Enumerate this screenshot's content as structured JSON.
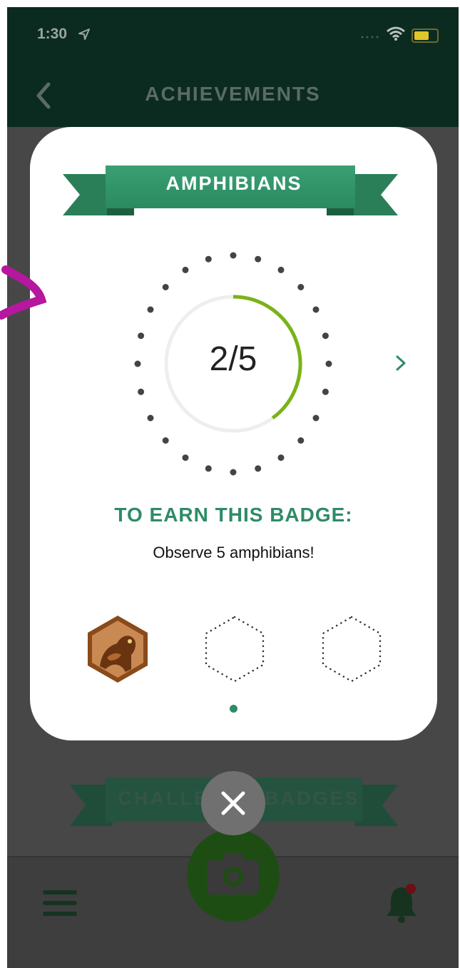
{
  "status_bar": {
    "time": "1:30"
  },
  "header": {
    "title": "ACHIEVEMENTS",
    "back_icon": "chevron-left-icon"
  },
  "modal": {
    "badge_title": "AMPHIBIANS",
    "progress": {
      "current": 2,
      "total": 5,
      "text": "2/5",
      "fraction": 0.4
    },
    "next_icon": "chevron-right-icon",
    "earn_heading": "TO EARN THIS BADGE:",
    "earn_description": "Observe 5 amphibians!",
    "badges": [
      {
        "name": "frog-badge",
        "earned": true
      },
      {
        "name": "empty-badge",
        "earned": false
      },
      {
        "name": "empty-badge",
        "earned": false
      }
    ]
  },
  "background": {
    "section_title": "CHALLENGE BADGES"
  },
  "bottom_nav": {
    "menu_icon": "hamburger-menu-icon",
    "camera_icon": "camera-icon",
    "bell_icon": "bell-icon"
  },
  "close_icon": "close-icon",
  "colors": {
    "header_bg": "#0b2b20",
    "accent_green": "#2e8b66",
    "progress_green": "#7ab317",
    "overlay": "#474747"
  }
}
